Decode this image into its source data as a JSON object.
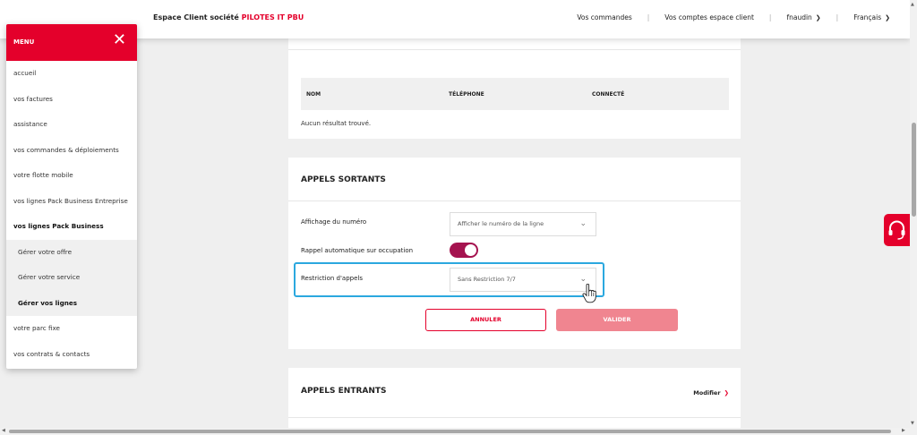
{
  "header": {
    "brand_prefix": "Espace Client société",
    "company": "PILOTES IT PBU",
    "nav": {
      "orders": "Vos commandes",
      "accounts": "Vos comptes espace client",
      "user": "fnaudin",
      "language": "Français"
    }
  },
  "menu": {
    "title": "MENU",
    "items": [
      "accueil",
      "vos factures",
      "assistance",
      "vos commandes & déploiements",
      "votre flotte mobile",
      "vos lignes Pack Business Entreprise",
      "vos lignes Pack Business",
      "Gérer votre offre",
      "Gérer votre service",
      "Gérer vos lignes",
      "votre parc fixe",
      "vos contrats & contacts"
    ]
  },
  "table": {
    "columns": [
      "NOM",
      "TÉLÉPHONE",
      "CONNECTÉ"
    ],
    "empty": "Aucun résultat trouvé."
  },
  "outgoing": {
    "title": "APPELS SORTANTS",
    "display_label": "Affichage du numéro",
    "display_value": "Afficher le numéro de la ligne",
    "recall_label": "Rappel automatique sur occupation",
    "recall_on": true,
    "restriction_label": "Restriction d'appels",
    "restriction_value": "Sans Restriction 7/7",
    "cancel": "ANNULER",
    "validate": "VALIDER"
  },
  "incoming": {
    "title": "APPELS ENTRANTS",
    "modify": "Modifier"
  },
  "colors": {
    "brand_red": "#e4002b",
    "toggle": "#a5134f",
    "highlight": "#2ba8df",
    "validate_disabled": "#f08590"
  },
  "icons": {
    "close": "close-icon",
    "chevron": "chevron-down-icon",
    "support": "headset-icon",
    "cursor": "hand-pointer-icon"
  }
}
